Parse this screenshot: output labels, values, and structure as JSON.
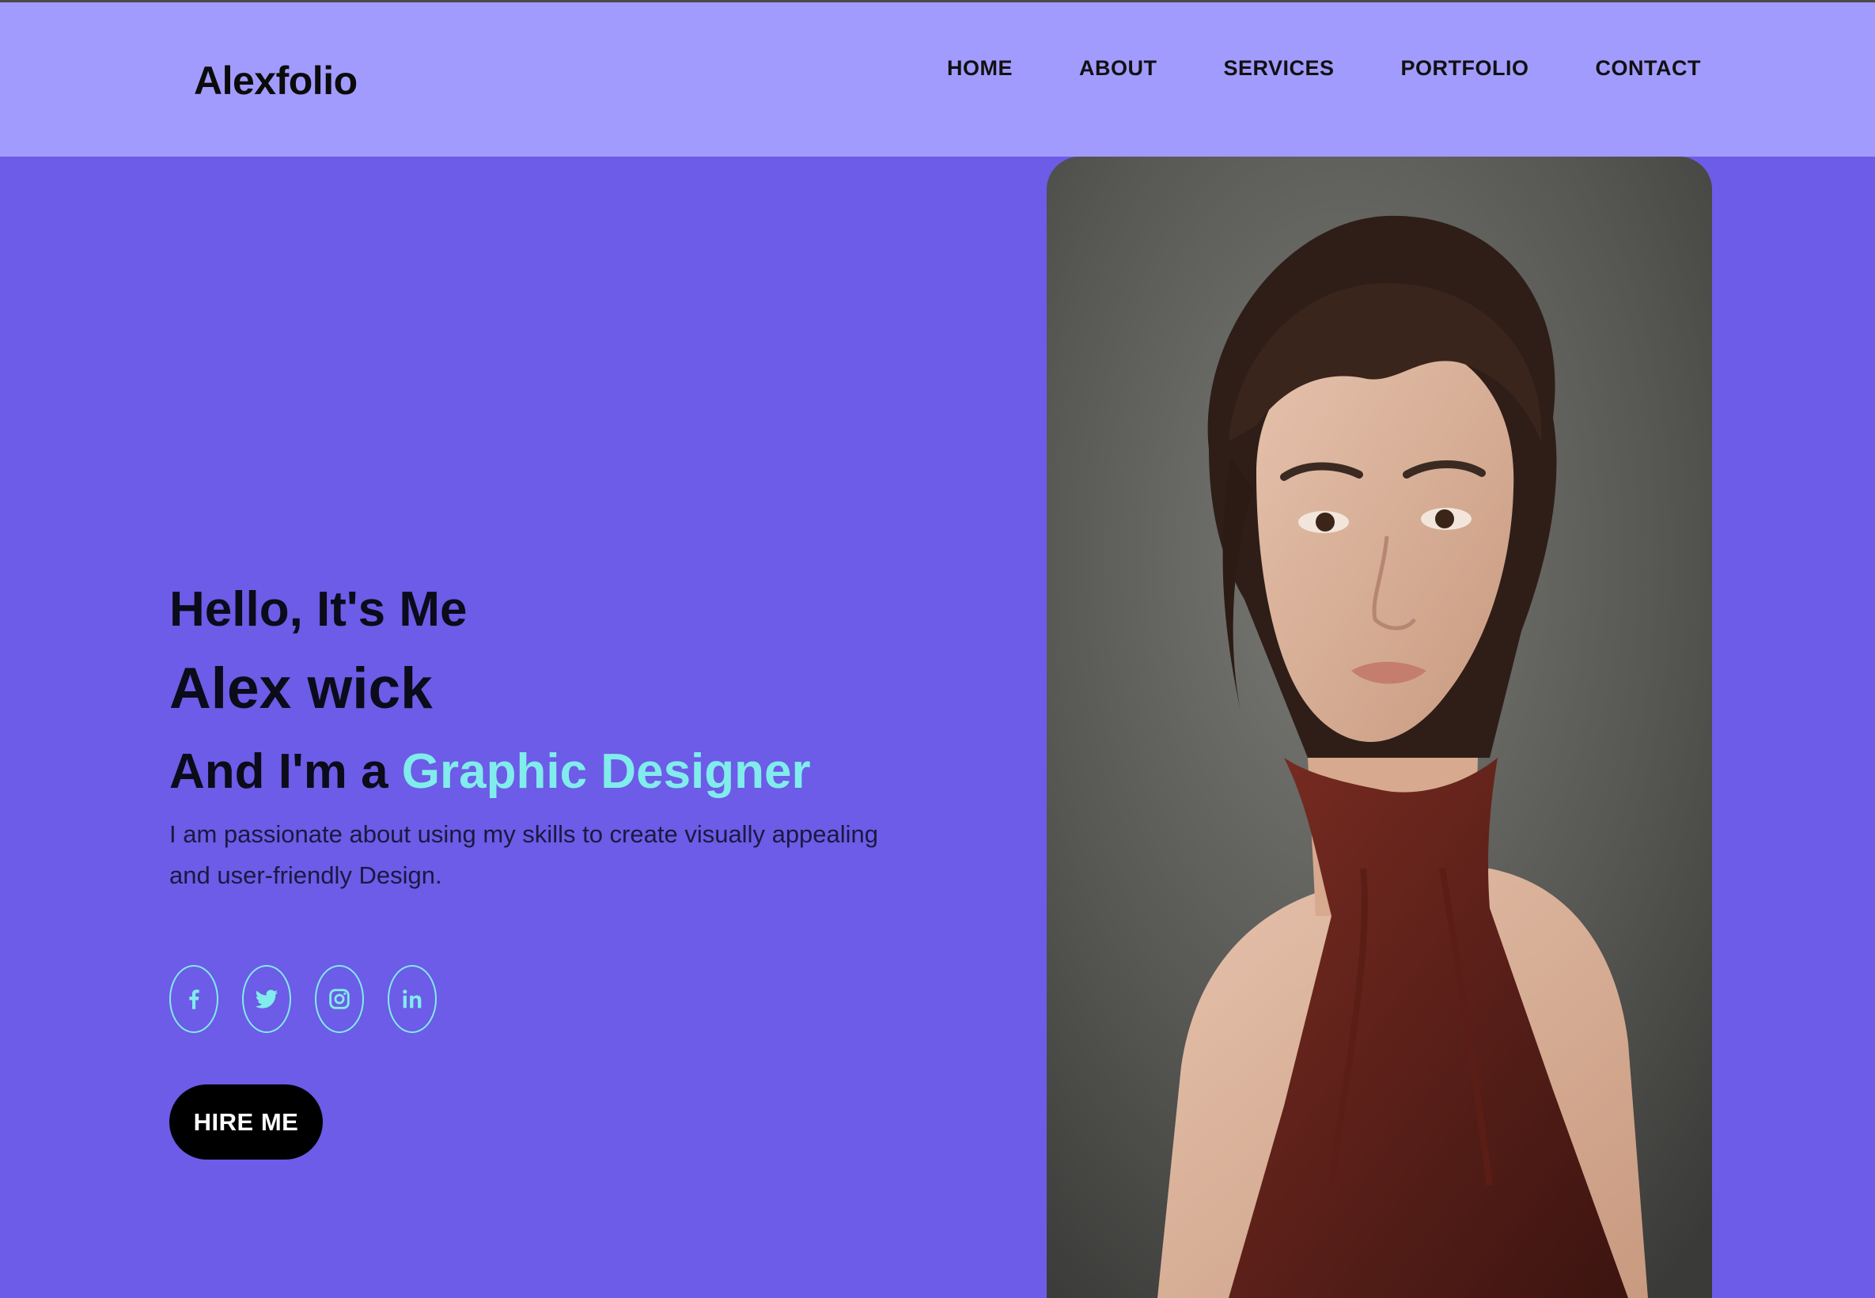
{
  "header": {
    "logo": "Alexfolio",
    "nav": [
      {
        "label": "HOME"
      },
      {
        "label": "ABOUT"
      },
      {
        "label": "SERVICES"
      },
      {
        "label": "PORTFOLIO"
      },
      {
        "label": "CONTACT"
      }
    ]
  },
  "hero": {
    "greeting": "Hello, It's Me",
    "name": "Alex wick",
    "role_prefix": "And I'm a",
    "role": "Graphic Designer",
    "description": "I am passionate about using my skills to create visually appealing and user-friendly Design.",
    "hire_label": "HIRE ME",
    "socials": [
      {
        "icon": "facebook-icon"
      },
      {
        "icon": "twitter-icon"
      },
      {
        "icon": "instagram-icon"
      },
      {
        "icon": "linkedin-icon"
      }
    ],
    "portrait": {
      "subject": "portrait-photo"
    }
  },
  "colors": {
    "background": "#6c5ce7",
    "header": "#a29bfe",
    "accent": "#81ecec",
    "button": "#000000"
  }
}
